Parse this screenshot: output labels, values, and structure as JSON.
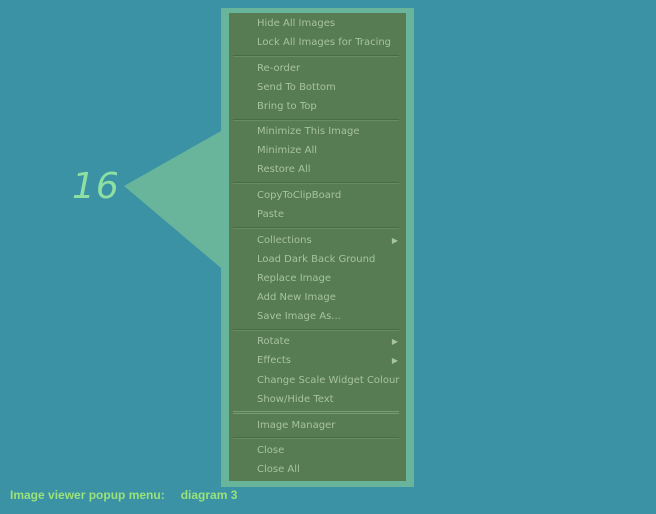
{
  "callout": {
    "number": "16"
  },
  "menu": {
    "groups": [
      [
        {
          "label": "Hide All Images"
        },
        {
          "label": "Lock All Images for Tracing"
        }
      ],
      [
        {
          "label": "Re-order"
        },
        {
          "label": "Send To Bottom"
        },
        {
          "label": "Bring to Top"
        }
      ],
      [
        {
          "label": "Minimize This Image"
        },
        {
          "label": "Minimize All"
        },
        {
          "label": "Restore All"
        }
      ],
      [
        {
          "label": "CopyToClipBoard"
        },
        {
          "label": "Paste"
        }
      ],
      [
        {
          "label": "Collections",
          "submenu": true,
          "arrow": "▶"
        },
        {
          "label": "Load Dark Back Ground"
        },
        {
          "label": "Replace Image"
        },
        {
          "label": "Add New Image"
        },
        {
          "label": "Save Image As..."
        }
      ],
      [
        {
          "label": "Rotate",
          "submenu": true,
          "arrow": "▶"
        },
        {
          "label": "Effects",
          "submenu": true,
          "arrow": "▶"
        },
        {
          "label": "Change Scale Widget Colour"
        },
        {
          "label": "Show/Hide Text"
        }
      ],
      [
        {
          "label": "Image Manager"
        }
      ],
      [
        {
          "label": "Close"
        },
        {
          "label": "Close All"
        }
      ]
    ]
  },
  "caption": {
    "label": "Image viewer popup menu:",
    "diagram": "diagram 3"
  },
  "colors": {
    "background": "#3a92a4",
    "callout": "#68b59c",
    "menu_background": "#577b53",
    "menu_text": "#a7c3a0",
    "caption_text": "#9be27a"
  }
}
